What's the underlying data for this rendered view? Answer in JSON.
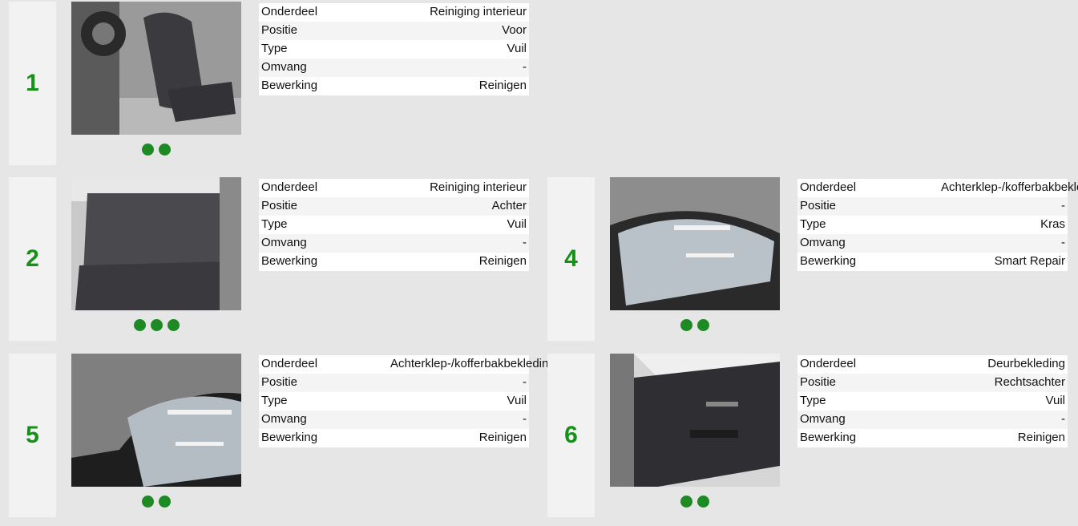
{
  "labels": {
    "part": "Onderdeel",
    "position": "Positie",
    "type": "Type",
    "extent": "Omvang",
    "action": "Bewerking"
  },
  "items": [
    {
      "number": "1",
      "part": "Reiniging interieur",
      "position": "Voor",
      "type": "Vuil",
      "extent": "-",
      "action": "Reinigen",
      "photo": "front-seat-interior",
      "dots": 2
    },
    {
      "number": "2",
      "part": "Reiniging interieur",
      "position": "Achter",
      "type": "Vuil",
      "extent": "-",
      "action": "Reinigen",
      "photo": "rear-seat-interior",
      "dots": 3
    },
    {
      "number": "4",
      "part": "Achterklep-/kofferbakbekleding",
      "position": "-",
      "type": "Kras",
      "extent": "-",
      "action": "Smart Repair",
      "photo": "tailgate-interior",
      "dots": 2
    },
    {
      "number": "5",
      "part": "Achterklep-/kofferbakbekleding",
      "position": "-",
      "type": "Vuil",
      "extent": "-",
      "action": "Reinigen",
      "photo": "tailgate-interior",
      "dots": 2
    },
    {
      "number": "6",
      "part": "Deurbekleding",
      "position": "Rechtsachter",
      "type": "Vuil",
      "extent": "-",
      "action": "Reinigen",
      "photo": "door-panel",
      "dots": 2
    }
  ],
  "colors": {
    "accent": "#15911a",
    "dot": "#1d8a24",
    "background": "#e6e6e6"
  }
}
